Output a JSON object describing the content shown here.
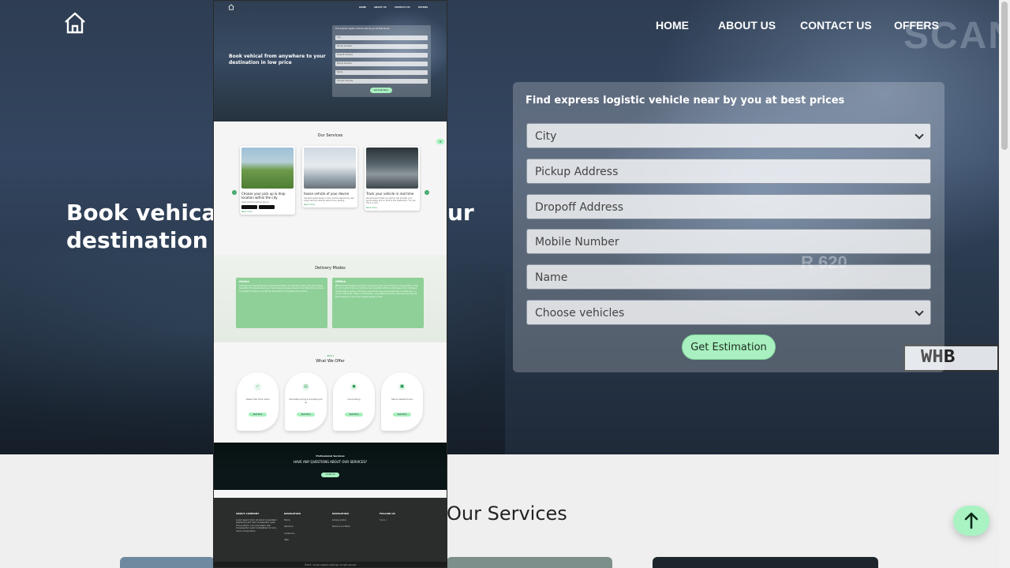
{
  "nav": {
    "items": [
      "HOME",
      "ABOUT US",
      "CONTACT US",
      "OFFERS"
    ]
  },
  "hero": {
    "headline_visible": "Book vehical",
    "headline_line2_visible": "destination in",
    "headline_tail": "ur",
    "plate_text": "WHB",
    "truck_brand": "SCAN",
    "model": "R 620"
  },
  "form": {
    "title": "Find express logistic vehicle near by you at best prices",
    "city": "City",
    "pickup": "Pickup Address",
    "dropoff": "Dropoff Address",
    "mobile": "Mobile Number",
    "name": "Name",
    "vehicles": "Choose vehicles",
    "submit": "Get Estimation"
  },
  "sections": {
    "services_title": "Our Services"
  },
  "preview": {
    "headline": "Book vehical from anywhere to your destination in low price",
    "services_title": "Our Services",
    "cards": [
      {
        "title": "Choose your pick up & drop location within the city",
        "text": "Download the partner app on",
        "link": "Read more.."
      },
      {
        "title": "hoose vehicle of your device",
        "text": "Get best quote based on the vehicle selected by user & get vehicle instantly without any waiting.",
        "link": "Read more.."
      },
      {
        "title": "Track your vehicle in real time",
        "text": "We will ensure that our partner will transfer your goods safely and on time to the destination. You can track on live.",
        "link": "Read more.."
      }
    ],
    "delivery_title": "Delivery Modes",
    "modes": [
      {
        "title": "Online",
        "text": "Online truck booking that has made transportation of materials a safe, quick and hassle-free affair. The latest advances in technology and easy access to the internet have made it possible for everyone to get the advantage of doorstep truck services."
      },
      {
        "title": "Offline",
        "text": "Efficient technologies have been deployed to track and manage all transportation done by our trusted drivers & customers are benefited with the advantages of an intelligent transportation system. It's time to face those many issues like high or hidden fare, no-arrival, wait times, delay in confirmation, unprofessional drivers. We have provided all these hassles in one of the easiest delivery mode."
      }
    ],
    "offers_small": "Offers",
    "offers_title": "What We Offer",
    "offers": [
      {
        "icon": "check-icon",
        "label": "Hassle Free Truck rental",
        "button": "Read More"
      },
      {
        "icon": "clipboard-icon",
        "label": "Favorable pricing & doorstep pick up",
        "button": "Read More"
      },
      {
        "icon": "location-pin-icon",
        "label": "Live tracking",
        "button": "Read More"
      },
      {
        "icon": "truck-icon",
        "label": "Safe & reliable trucks",
        "button": "Read More"
      }
    ],
    "cta_small": "Professional Services",
    "cta_title": "HAVE ANY QUESTIONS ABOUT OUR SERVICES?",
    "cta_button": "Contact Us",
    "footer": {
      "about_title": "ABOUT COMPANY",
      "about_text": "Lorem ipsum dolor sit amet consectetur adipisicing elit. Sed consequatur quas. The problem, cum que ipsam iste. Consequatur quam voluptates? Ad iure, rerum, temporibus.",
      "nav_title": "NAVIGATION",
      "nav_items": [
        "Home",
        "About us",
        "contact us",
        "offer"
      ],
      "nav2_title": "NAVIGATION",
      "nav2_items": [
        "privacy policy",
        "terms & condition"
      ],
      "follow_title": "FOLLOW US",
      "follow_icons": "f  ◎  in  ✓",
      "copyright": "©2023 - Gomas Logistics enterprise. All right reserved"
    }
  },
  "colors": {
    "accent_green": "#a8f0bf",
    "link_green": "#2f9e5a",
    "mode_green": "#8fd098",
    "dark_footer": "#2b2c2c"
  }
}
